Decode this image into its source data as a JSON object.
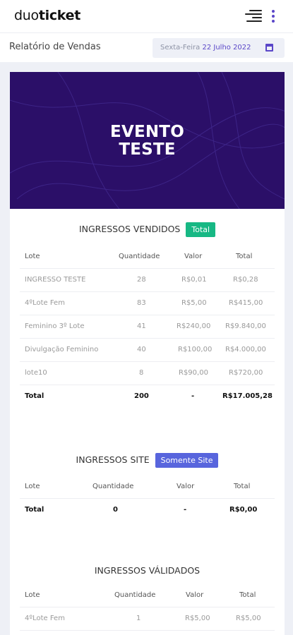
{
  "header": {
    "logo_thin": "duo",
    "logo_bold": "ticket",
    "title": "Relatório de Vendas",
    "date_weekday": "Sexta-Feira",
    "date_value": "22 Julho 2022"
  },
  "event": {
    "title_line1": "EVENTO",
    "title_line2": "TESTE"
  },
  "sold": {
    "title": "INGRESSOS VENDIDOS",
    "badge": "Total",
    "columns": [
      "Lote",
      "Quantidade",
      "Valor",
      "Total"
    ],
    "rows": [
      {
        "lote": "INGRESSO TESTE",
        "qtd": "28",
        "valor": "R$0,01",
        "total": "R$0,28"
      },
      {
        "lote": "4ºLote Fem",
        "qtd": "83",
        "valor": "R$5,00",
        "total": "R$415,00"
      },
      {
        "lote": "Feminino 3º Lote",
        "qtd": "41",
        "valor": "R$240,00",
        "total": "R$9.840,00"
      },
      {
        "lote": "Divulgação Feminino",
        "qtd": "40",
        "valor": "R$100,00",
        "total": "R$4.000,00"
      },
      {
        "lote": "lote10",
        "qtd": "8",
        "valor": "R$90,00",
        "total": "R$720,00"
      }
    ],
    "footer": {
      "label": "Total",
      "qtd": "200",
      "valor": "-",
      "total": "R$17.005,28"
    }
  },
  "site": {
    "title": "INGRESSOS SITE",
    "badge": "Somente Site",
    "columns": [
      "Lote",
      "Quantidade",
      "Valor",
      "Total"
    ],
    "footer": {
      "label": "Total",
      "qtd": "0",
      "valor": "-",
      "total": "R$0,00"
    }
  },
  "validated": {
    "title": "INGRESSOS VÁLIDADOS",
    "columns": [
      "Lote",
      "Quantidade",
      "Valor",
      "Total"
    ],
    "rows": [
      {
        "lote": "4ºLote Fem",
        "qtd": "1",
        "valor": "R$5,00",
        "total": "R$5,00"
      }
    ]
  },
  "colors": {
    "banner": "#2b0f68",
    "accent": "#5a46c8",
    "badge_total": "#17b884",
    "badge_site": "#5865dd"
  },
  "icons": [
    "hamburger-menu-icon",
    "more-vertical-icon",
    "calendar-icon"
  ]
}
